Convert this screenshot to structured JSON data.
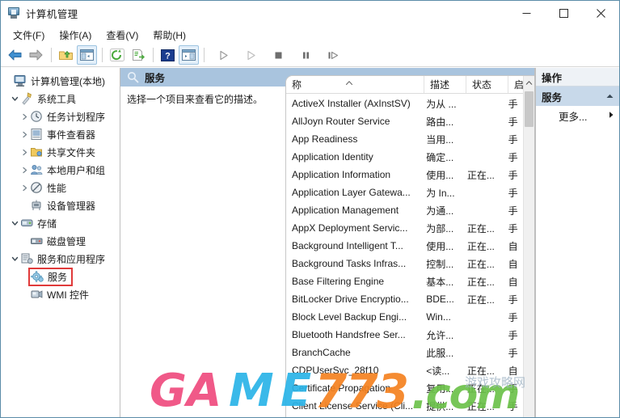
{
  "window": {
    "title": "计算机管理",
    "title_icon": "computer-management-icon",
    "minimize_label": "–",
    "maximize_label": "□",
    "close_label": "✕"
  },
  "menubar": {
    "items": [
      {
        "label": "文件(F)"
      },
      {
        "label": "操作(A)"
      },
      {
        "label": "查看(V)"
      },
      {
        "label": "帮助(H)"
      }
    ]
  },
  "toolbar": {
    "buttons": [
      {
        "name": "back-icon",
        "title": "后退"
      },
      {
        "name": "forward-icon",
        "title": "前进"
      },
      {
        "name": "up-folder-icon",
        "title": "向上"
      },
      {
        "name": "show-tree-pane-icon",
        "title": "显示/隐藏控制台树"
      },
      {
        "name": "refresh-icon",
        "title": "刷新"
      },
      {
        "name": "export-list-icon",
        "title": "导出列表"
      },
      {
        "name": "help-icon",
        "title": "帮助"
      },
      {
        "name": "show-action-pane-icon",
        "title": "显示/隐藏操作窗格"
      },
      {
        "name": "play-icon",
        "title": "启动服务"
      },
      {
        "name": "start-icon",
        "title": "启动"
      },
      {
        "name": "stop-icon",
        "title": "停止服务"
      },
      {
        "name": "pause-icon",
        "title": "暂停服务"
      },
      {
        "name": "restart-icon",
        "title": "重启服务"
      }
    ]
  },
  "tree": {
    "items": [
      {
        "label": "计算机管理(本地)",
        "indent": 0,
        "chevron": "none",
        "icon": "computer-icon",
        "selected": false
      },
      {
        "label": "系统工具",
        "indent": 1,
        "chevron": "expanded",
        "icon": "tools-icon",
        "selected": false
      },
      {
        "label": "任务计划程序",
        "indent": 2,
        "chevron": "collapsed",
        "icon": "clock-icon",
        "selected": false
      },
      {
        "label": "事件查看器",
        "indent": 2,
        "chevron": "collapsed",
        "icon": "event-viewer-icon",
        "selected": false
      },
      {
        "label": "共享文件夹",
        "indent": 2,
        "chevron": "collapsed",
        "icon": "shared-folder-icon",
        "selected": false
      },
      {
        "label": "本地用户和组",
        "indent": 2,
        "chevron": "collapsed",
        "icon": "users-icon",
        "selected": false
      },
      {
        "label": "性能",
        "indent": 2,
        "chevron": "collapsed",
        "icon": "performance-icon",
        "selected": false
      },
      {
        "label": "设备管理器",
        "indent": 2,
        "chevron": "none",
        "icon": "device-manager-icon",
        "selected": false
      },
      {
        "label": "存储",
        "indent": 1,
        "chevron": "expanded",
        "icon": "storage-icon",
        "selected": false
      },
      {
        "label": "磁盘管理",
        "indent": 2,
        "chevron": "none",
        "icon": "disk-icon",
        "selected": false
      },
      {
        "label": "服务和应用程序",
        "indent": 1,
        "chevron": "expanded",
        "icon": "services-apps-icon",
        "selected": false
      },
      {
        "label": "服务",
        "indent": 2,
        "chevron": "none",
        "icon": "gear-icon",
        "selected": true
      },
      {
        "label": "WMI 控件",
        "indent": 2,
        "chevron": "none",
        "icon": "wmi-icon",
        "selected": false
      }
    ],
    "highlight_color": "#e03a3a"
  },
  "center": {
    "header_title": "服务",
    "header_icon": "search-icon",
    "description_text": "选择一个项目来查看它的描述。"
  },
  "list": {
    "columns": [
      {
        "key": "name",
        "label": "称",
        "sorted": true,
        "sort_arrow": "^"
      },
      {
        "key": "desc",
        "label": "描述",
        "sorted": false
      },
      {
        "key": "state",
        "label": "状态",
        "sorted": false
      },
      {
        "key": "start",
        "label": "启",
        "sorted": false
      }
    ],
    "rows": [
      {
        "name": "ActiveX Installer (AxInstSV)",
        "desc": "为从 ...",
        "state": "",
        "start": "手"
      },
      {
        "name": "AllJoyn Router Service",
        "desc": "路由...",
        "state": "",
        "start": "手"
      },
      {
        "name": "App Readiness",
        "desc": "当用...",
        "state": "",
        "start": "手"
      },
      {
        "name": "Application Identity",
        "desc": "确定...",
        "state": "",
        "start": "手"
      },
      {
        "name": "Application Information",
        "desc": "使用...",
        "state": "正在...",
        "start": "手"
      },
      {
        "name": "Application Layer Gatewa...",
        "desc": "为 In...",
        "state": "",
        "start": "手"
      },
      {
        "name": "Application Management",
        "desc": "为通...",
        "state": "",
        "start": "手"
      },
      {
        "name": "AppX Deployment Servic...",
        "desc": "为部...",
        "state": "正在...",
        "start": "手"
      },
      {
        "name": "Background Intelligent T...",
        "desc": "使用...",
        "state": "正在...",
        "start": "自"
      },
      {
        "name": "Background Tasks Infras...",
        "desc": "控制...",
        "state": "正在...",
        "start": "自"
      },
      {
        "name": "Base Filtering Engine",
        "desc": "基本...",
        "state": "正在...",
        "start": "自"
      },
      {
        "name": "BitLocker Drive Encryptio...",
        "desc": "BDE...",
        "state": "正在...",
        "start": "手"
      },
      {
        "name": "Block Level Backup Engi...",
        "desc": "Win...",
        "state": "",
        "start": "手"
      },
      {
        "name": "Bluetooth Handsfree Ser...",
        "desc": "允许...",
        "state": "",
        "start": "手"
      },
      {
        "name": "BranchCache",
        "desc": "此服...",
        "state": "",
        "start": "手"
      },
      {
        "name": "CDPUserSvc_28f10",
        "desc": "<读...",
        "state": "正在...",
        "start": "自"
      },
      {
        "name": "Certificate Propagation",
        "desc": "复用...",
        "state": "正在...",
        "start": "手"
      },
      {
        "name": "Client License Service (Cli...",
        "desc": "提供...",
        "state": "正在...",
        "start": "手"
      }
    ]
  },
  "actions": {
    "header": "操作",
    "group_title": "服务",
    "group_collapse_icon": "chevron-up-icon",
    "items": [
      {
        "label": "更多...",
        "submenu_icon": "chevron-right-icon"
      }
    ]
  },
  "watermark": {
    "part1": "G",
    "part2": "A",
    "part3": "M",
    "part4": "E",
    "part5": "773",
    "part6": ".com",
    "subtext": "游戏攻略网"
  }
}
